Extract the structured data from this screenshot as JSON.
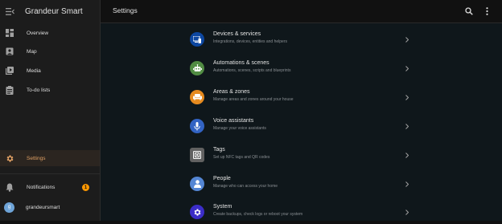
{
  "sidebar": {
    "title": "Grandeur Smart",
    "items": [
      {
        "label": "Overview",
        "icon": "dashboard-icon"
      },
      {
        "label": "Map",
        "icon": "map-icon"
      },
      {
        "label": "Media",
        "icon": "media-icon"
      },
      {
        "label": "To-do lists",
        "icon": "clipboard-list-icon"
      }
    ],
    "settings_label": "Settings",
    "notifications_label": "Notifications",
    "notifications_count": "1",
    "user_name": "grandeursmart",
    "user_initial": "g"
  },
  "header": {
    "title": "Settings"
  },
  "settings": [
    {
      "title": "Devices & services",
      "subtitle": "Integrations, devices, entities and helpers",
      "color": "#0d47a1",
      "icon": "devices-icon"
    },
    {
      "title": "Automations & scenes",
      "subtitle": "Automations, scenes, scripts and blueprints",
      "color": "#518c43",
      "icon": "robot-icon"
    },
    {
      "title": "Areas & zones",
      "subtitle": "Manage areas and zones around your house",
      "color": "#e68a1f",
      "icon": "sofa-icon"
    },
    {
      "title": "Voice assistants",
      "subtitle": "Manage your voice assistants",
      "color": "#3263c3",
      "icon": "microphone-icon"
    },
    {
      "title": "Tags",
      "subtitle": "Set up NFC tags and QR codes",
      "color": "#616161",
      "icon": "tag-icon"
    },
    {
      "title": "People",
      "subtitle": "Manage who can access your home",
      "color": "#5486d4",
      "icon": "person-icon"
    },
    {
      "title": "System",
      "subtitle": "Create backups, check logs or reboot your system",
      "color": "#3b2dc8",
      "icon": "gear-icon"
    }
  ],
  "colors": {
    "accent": "#ff9800",
    "active_label": "#e0a064",
    "sidebar_bg": "#1c1c1c",
    "main_bg": "#0f171b"
  }
}
